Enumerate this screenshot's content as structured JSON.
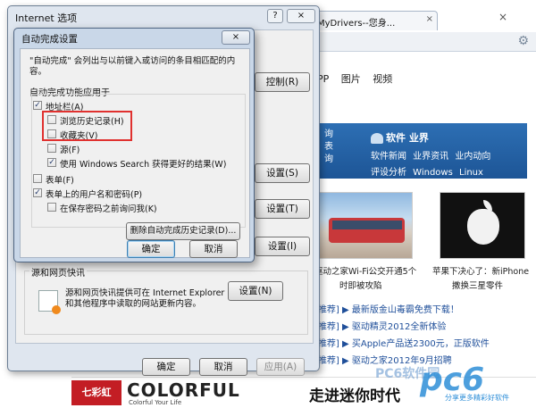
{
  "browser": {
    "tab_title": "动之家MyDrivers--您身...",
    "tab_close": "×",
    "window_close": "×",
    "nav_links": [
      "PP",
      "图片",
      "视频"
    ],
    "band": {
      "title": "软件 业界",
      "row1": "软件新闻 业界资讯 业内动向",
      "row2": "评设分析 Windows Linux",
      "left_lines": [
        "询",
        "表",
        "询"
      ]
    },
    "captions": {
      "bus": "驱动之家Wi-Fi公交开通5个",
      "bus_sub": "时即被攻陷",
      "apple": "苹果下决心了：新iPhone",
      "apple_sub": "撒换三星零件"
    },
    "news": [
      {
        "tag": "[推荐]",
        "text": "▶ 最新版金山毒霸免费下载！"
      },
      {
        "tag": "[推荐]",
        "text": "▶ 驱动精灵2012全新体验"
      },
      {
        "tag": "[推荐]",
        "text": "▶ 买Apple产品送2300元，正版软件"
      },
      {
        "tag": "[推荐]",
        "text": "▶ 驱动之家2012年9月招聘"
      }
    ],
    "ad": {
      "logo": "七彩虹",
      "brand": "COLORFUL",
      "brand_sub": "Colorful Your Life",
      "slogan": "走进迷你时代"
    },
    "watermark": "pc6",
    "watermark_brand": "PC6软件园",
    "watermark_sub": "分享更多精彩好软件"
  },
  "internet_options": {
    "title": "Internet 选项",
    "help": "?",
    "close": "×",
    "right_buttons": [
      "设置(S)",
      "设置(T)",
      "设置(I)",
      "设置(N)"
    ],
    "right_button_top": "控制(R)",
    "feeds_group_title": "源和网页快讯",
    "feeds_text": "源和网页快讯提供可在 Internet Explorer 和其他程序中读取的网站更新内容。",
    "feeds_settings": "设置(N)",
    "ok": "确定",
    "cancel": "取消",
    "apply": "应用(A)"
  },
  "autocomplete": {
    "title": "自动完成设置",
    "close": "×",
    "description": "\"自动完成\" 会列出与以前键入或访问的条目相匹配的内容。",
    "group_label": "自动完成功能应用于",
    "items": [
      {
        "label": "地址栏(A)",
        "checked": true
      },
      {
        "label": "浏览历史记录(H)",
        "checked": false
      },
      {
        "label": "收藏夹(V)",
        "checked": false
      },
      {
        "label": "源(F)",
        "checked": false
      },
      {
        "label": "使用 Windows Search 获得更好的结果(W)",
        "checked": true
      },
      {
        "label": "表单(F)",
        "checked": false
      },
      {
        "label": "表单上的用户名和密码(P)",
        "checked": true
      },
      {
        "label": "在保存密码之前询问我(K)",
        "checked": false
      }
    ],
    "delete_history": "删除自动完成历史记录(D)...",
    "ok": "确定",
    "cancel": "取消",
    "highlight_color": "#e0312f"
  }
}
